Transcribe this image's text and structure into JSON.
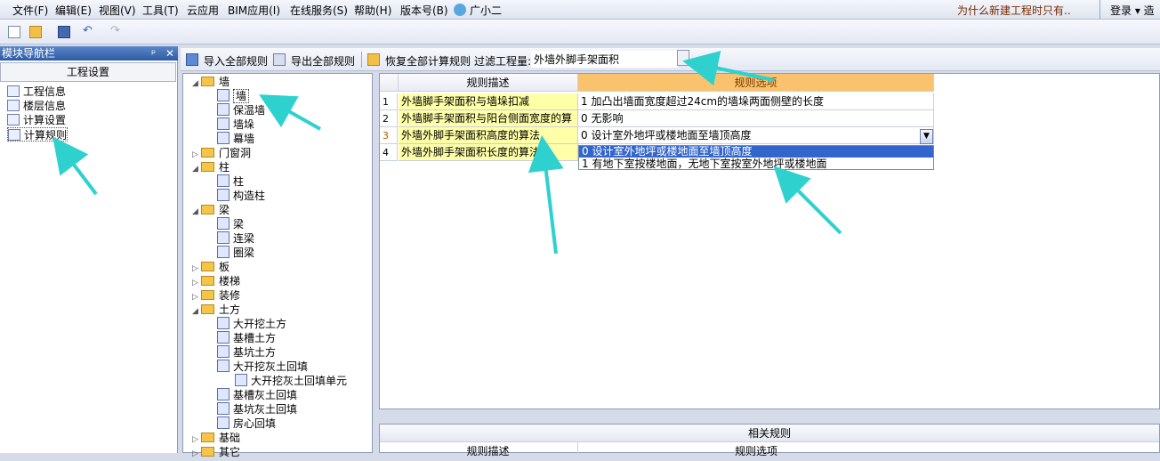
{
  "menubar": {
    "items": [
      "文件(F)",
      "编辑(E)",
      "视图(V)",
      "工具(T)",
      "云应用",
      "BIM应用(I)",
      "在线服务(S)",
      "帮助(H)",
      "版本号(B)",
      "广小二"
    ],
    "notice": "为什么新建工程时只有..",
    "login": "登录 ▾ 造"
  },
  "nav": {
    "title": "模块导航栏",
    "pin": "ᵖ",
    "close": "✕",
    "section": "工程设置",
    "items": [
      "工程信息",
      "楼层信息",
      "计算设置",
      "计算规则"
    ]
  },
  "toolbar": {
    "import_all": "导入全部规则",
    "export_all": "导出全部规则",
    "restore_all": "恢复全部计算规则",
    "filter_label": "过滤工程量:",
    "filter_value": "外墙外脚手架面积"
  },
  "tree": {
    "nodes": [
      {
        "label": "墙",
        "kind": "folder",
        "expanded": true
      },
      {
        "label": "墙",
        "kind": "leaf",
        "selected": true
      },
      {
        "label": "保温墙",
        "kind": "leaf"
      },
      {
        "label": "墙垛",
        "kind": "leaf"
      },
      {
        "label": "幕墙",
        "kind": "leaf"
      },
      {
        "label": "门窗洞",
        "kind": "folder"
      },
      {
        "label": "柱",
        "kind": "folder",
        "expanded": true
      },
      {
        "label": "柱",
        "kind": "leaf"
      },
      {
        "label": "构造柱",
        "kind": "leaf"
      },
      {
        "label": "梁",
        "kind": "folder",
        "expanded": true
      },
      {
        "label": "梁",
        "kind": "leaf"
      },
      {
        "label": "连梁",
        "kind": "leaf"
      },
      {
        "label": "圈梁",
        "kind": "leaf"
      },
      {
        "label": "板",
        "kind": "folder"
      },
      {
        "label": "楼梯",
        "kind": "folder"
      },
      {
        "label": "装修",
        "kind": "folder"
      },
      {
        "label": "土方",
        "kind": "folder",
        "expanded": true
      },
      {
        "label": "大开挖土方",
        "kind": "leaf"
      },
      {
        "label": "基槽土方",
        "kind": "leaf"
      },
      {
        "label": "基坑土方",
        "kind": "leaf"
      },
      {
        "label": "大开挖灰土回填",
        "kind": "leaf"
      },
      {
        "label": "大开挖灰土回填单元",
        "kind": "leaf"
      },
      {
        "label": "基槽灰土回填",
        "kind": "leaf"
      },
      {
        "label": "基坑灰土回填",
        "kind": "leaf"
      },
      {
        "label": "房心回填",
        "kind": "leaf"
      },
      {
        "label": "基础",
        "kind": "folder"
      },
      {
        "label": "其它",
        "kind": "folder"
      }
    ]
  },
  "grid": {
    "headers": {
      "desc": "规则描述",
      "option": "规则选项"
    },
    "rows": [
      {
        "num": "1",
        "desc": "外墙脚手架面积与墙垛扣减",
        "option": "1 加凸出墙面宽度超过24cm的墙垛两面侧壁的长度"
      },
      {
        "num": "2",
        "desc": "外墙脚手架面积与阳台侧面宽度的算",
        "option": "0  无影响"
      },
      {
        "num": "3",
        "desc": "外墙外脚手架面积高度的算法",
        "option": "0 设计室外地坪或楼地面至墙顶高度"
      },
      {
        "num": "4",
        "desc": "外墙外脚手架面积长度的算法",
        "option": ""
      }
    ],
    "dropdown": {
      "button": "▼",
      "options": [
        "0 设计室外地坪或楼地面至墙顶高度",
        "1 有地下室按楼地面，无地下室按室外地坪或楼地面"
      ]
    }
  },
  "related": {
    "title": "相关规则",
    "headers": {
      "desc": "规则描述",
      "option": "规则选项"
    }
  },
  "colors": {
    "accent_header": "#f8c36c",
    "desc_bg": "#ffffa8",
    "selection": "#3366cc",
    "arrow": "#2fd1cf"
  }
}
